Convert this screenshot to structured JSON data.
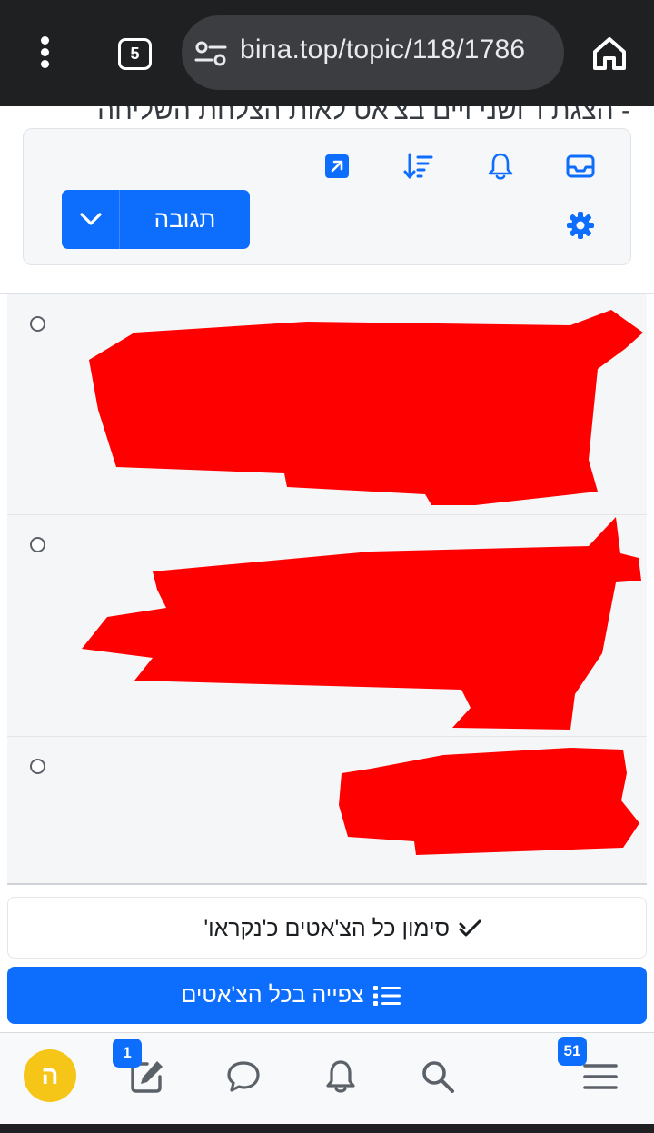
{
  "browser": {
    "tab_count": "5",
    "url": "bina.top/topic/118/1786",
    "icons": [
      "menu-dots-icon",
      "tabs-icon",
      "site-settings-icon",
      "home-icon"
    ]
  },
  "topic": {
    "title": "- הצגת ו' ושני ויים בצ'אט לאות הצלחת השליחה"
  },
  "toolbar": {
    "reply_label": "תגובה",
    "icons": [
      "inbox-icon",
      "bell-icon",
      "sort-icon",
      "open-external-icon",
      "gear-icon",
      "chevron-down-icon"
    ]
  },
  "chats": {
    "items": [
      {
        "state": "unselected",
        "content": "redacted"
      },
      {
        "state": "unselected",
        "content": "redacted"
      },
      {
        "state": "unselected",
        "content": "redacted"
      }
    ],
    "redaction_color": "#ff0000"
  },
  "actions": {
    "mark_all_read": "סימון כל הצ'אטים כ'נקראו'",
    "view_all_chats": "צפייה בכל הצ'אטים"
  },
  "bottom_nav": {
    "avatar_letter": "ה",
    "compose_badge": "1",
    "menu_badge": "51",
    "icons": [
      "compose-icon",
      "chat-icon",
      "bell-icon",
      "search-icon",
      "hamburger-menu-icon"
    ]
  },
  "colors": {
    "accent": "#0d6efd",
    "browser_bar": "#1f2022",
    "avatar": "#f5c518"
  }
}
